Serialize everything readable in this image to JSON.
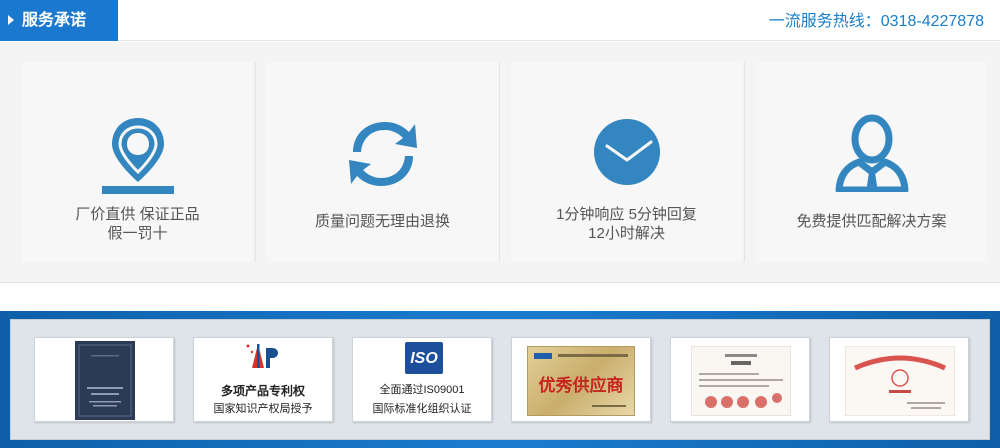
{
  "header": {
    "tab_label": "服务承诺",
    "hotline": "一流服务热线：0318-4227878"
  },
  "promises": [
    {
      "icon": "location-pin-icon",
      "lines": [
        "厂价直供  保证正品",
        "假一罚十"
      ]
    },
    {
      "icon": "exchange-arrows-icon",
      "lines": [
        "质量问题无理由退换"
      ]
    },
    {
      "icon": "clock-icon",
      "lines": [
        "1分钟响应   5分钟回复",
        "12小时解决"
      ]
    },
    {
      "icon": "support-person-icon",
      "lines": [
        "免费提供匹配解决方案"
      ]
    }
  ],
  "certificates": [
    {
      "icon": "certificate-booklet-icon",
      "captions": []
    },
    {
      "icon": "patent-logo-icon",
      "captions": [
        "多项产品专利权",
        "国家知识产权局授予"
      ]
    },
    {
      "icon": "iso-logo-icon",
      "logo_text": "ISO",
      "captions": [
        "全面通过IS09001",
        "国际标准化组织认证"
      ]
    },
    {
      "icon": "award-plaque-icon",
      "plaque_text": "优秀供应商",
      "captions": []
    },
    {
      "icon": "certificate-document-icon",
      "captions": []
    },
    {
      "icon": "famous-trademark-certificate-icon",
      "captions": []
    }
  ],
  "colors": {
    "accent": "#1a79cf",
    "icon_blue": "#3386bf",
    "hotline": "#1a7fc8"
  }
}
